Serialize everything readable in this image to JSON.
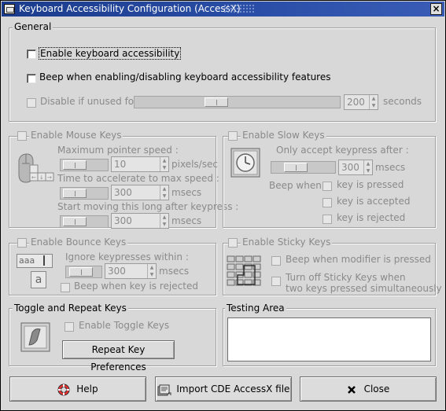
{
  "window": {
    "title": "Keyboard Accessibility Configuration (AccessX)",
    "close_glyph": "×"
  },
  "general": {
    "legend": "General",
    "enable_access": {
      "label": "Enable keyboard accessibility",
      "checked": false
    },
    "beep_toggle": {
      "label": "Beep when enabling/disabling keyboard accessibility features",
      "checked": false
    },
    "disable_unused": {
      "label": "Disable if unused for",
      "value": "200",
      "unit": "seconds",
      "checked": false,
      "slider_fraction": 0.39
    }
  },
  "mouse_keys": {
    "legend": "Enable Mouse Keys",
    "max_speed": {
      "label": "Maximum pointer speed :",
      "value": "10",
      "unit": "pixels/sec"
    },
    "accel_time": {
      "label": "Time to accelerate to max speed :",
      "value": "300",
      "unit": "msecs"
    },
    "delay": {
      "label": "Start moving this long after keypress :",
      "value": "300",
      "unit": "msecs"
    }
  },
  "slow_keys": {
    "legend": "Enable Slow Keys",
    "accept_after": {
      "label": "Only accept keypress after :",
      "value": "300",
      "unit": "msecs"
    },
    "beep_when": "Beep when:",
    "options": [
      "key is pressed",
      "key is accepted",
      "key is rejected"
    ]
  },
  "bounce_keys": {
    "legend": "Enable Bounce Keys",
    "ignore_within": {
      "label": "Ignore keypresses within  :",
      "value": "300",
      "unit": "msecs"
    },
    "beep_rejected": "Beep when key is rejected",
    "icon_text_top": "aaa",
    "icon_text_bottom": "a"
  },
  "sticky_keys": {
    "legend": "Enable Sticky Keys",
    "beep_modifier": "Beep when modifier is pressed",
    "turn_off_line1": "Turn off Sticky Keys when",
    "turn_off_line2": "two keys pressed simultaneously"
  },
  "toggle_repeat": {
    "legend": "Toggle and Repeat Keys",
    "enable_toggle": "Enable Toggle Keys",
    "repeat_button": "Repeat Key Preferences"
  },
  "testing": {
    "legend": "Testing Area",
    "text": ""
  },
  "buttons": {
    "help": "Help",
    "import": "Import CDE AccessX file",
    "close": "Close"
  },
  "icons": {
    "help": "lifebuoy-icon",
    "import": "import-file-icon",
    "close": "x-close-icon",
    "mouse": "mouse-keys-icon",
    "slow": "clock-key-icon",
    "bounce": "bounce-keys-icon",
    "sticky": "sticky-keys-icon",
    "toggle": "toggle-keys-icon"
  }
}
